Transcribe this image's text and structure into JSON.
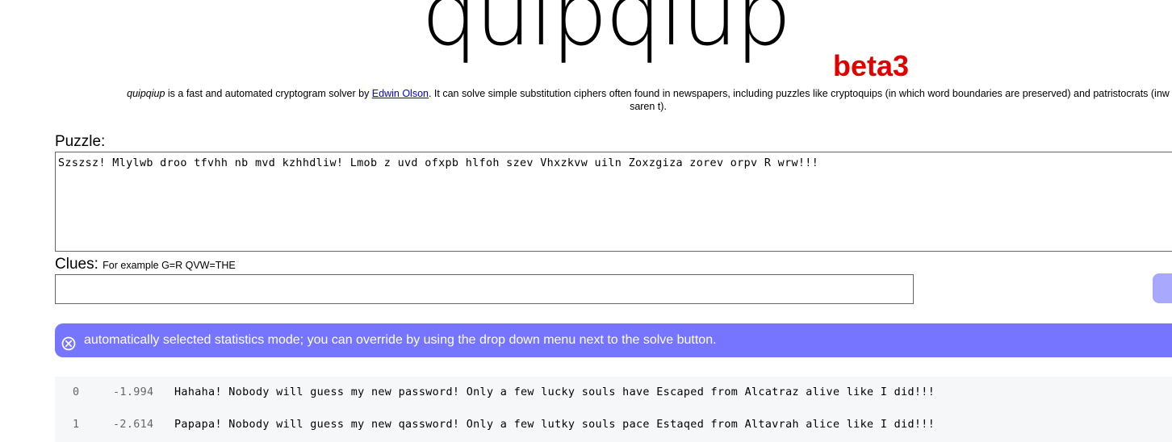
{
  "header": {
    "logo_text": "quipqiup",
    "beta_label": "beta3",
    "beta_color": "#e00000"
  },
  "description": {
    "app_name": "quipqiup",
    "text_before_link": " is a fast and automated cryptogram solver by ",
    "author_link": "Edwin Olson",
    "text_after_link": ". It can solve simple substitution ciphers often found in newspapers, including puzzles like cryptoquips (in which word boundaries are preserved) and patristocrats (inw",
    "line2": "saren t)."
  },
  "puzzle": {
    "label": "Puzzle:",
    "value": "Szszsz! Mlylwb droo tfvhh nb mvd kzhhdliw! Lmob z uvd ofxpb hlfoh szev Vhxzkvw uiln Zoxzgiza zorev orpv R wrw!!!"
  },
  "clues": {
    "label": "Clues:",
    "hint": "For example G=R QVW=THE",
    "value": ""
  },
  "notice": {
    "icon": "close-circle-icon",
    "text": "automatically selected statistics mode; you can override by using the drop down menu next to the solve button.",
    "color": "#7575ff"
  },
  "results": [
    {
      "index": "0",
      "score": "-1.994",
      "text": "Hahaha! Nobody will guess my new password! Only a few lucky souls have Escaped from Alcatraz alive like I did!!!"
    },
    {
      "index": "1",
      "score": "-2.614",
      "text": "Papapa! Nobody will guess my new qassword! Only a few lutky souls pace Estaqed from Altavrah alice like I did!!!"
    }
  ]
}
